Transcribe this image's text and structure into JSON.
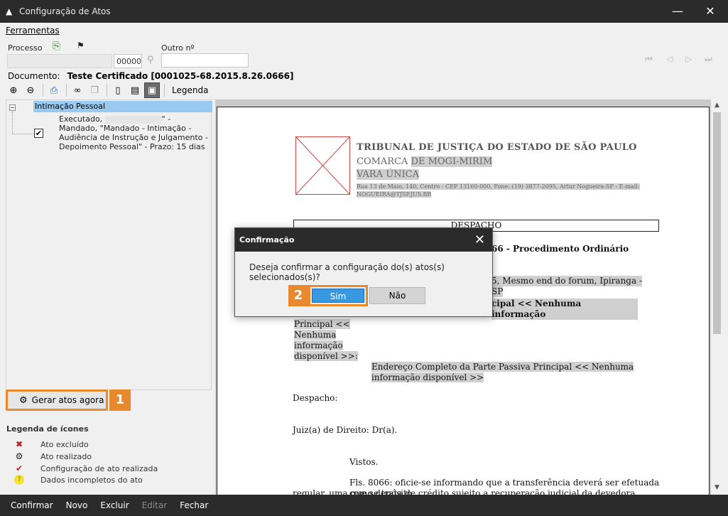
{
  "window": {
    "title": "Configuração de Atos",
    "minimize": "—",
    "close": "✕"
  },
  "menu": {
    "ferramentas": "Ferramentas"
  },
  "process": {
    "label_processo": "Processo",
    "label_outro": "Outro nº",
    "field_suffix": "00000"
  },
  "document": {
    "label": "Documento:",
    "value": "Teste Certificado [0001025-68.2015.8.26.0666]"
  },
  "toolbar": {
    "legend_label": "Legenda"
  },
  "tree": {
    "root_label": "Intimação Pessoal",
    "item_prefix": "Executado,",
    "item_text": "\" - Mandado, \"Mandado - Intimação - Audiência de Instrução e Julgamento - Depoimento Pessoal\" - Prazo: 15 dias"
  },
  "gerar_button": "Gerar atos agora",
  "steps": {
    "one": "1",
    "two": "2"
  },
  "legend": {
    "title": "Legenda de ícones",
    "items": [
      {
        "icon": "x-icon",
        "glyph": "✖",
        "color": "#c0201c",
        "label": "Ato excluído"
      },
      {
        "icon": "gear-icon",
        "glyph": "⚙",
        "color": "#222222",
        "label": "Ato realizado"
      },
      {
        "icon": "checkmark-icon",
        "glyph": "✔",
        "color": "#d0201c",
        "label": "Configuração de ato realizada"
      },
      {
        "icon": "question-icon",
        "glyph": "?",
        "color": "#e0b800",
        "label": "Dados incompletos do ato"
      }
    ]
  },
  "bottom": {
    "confirmar": "Confirmar",
    "novo": "Novo",
    "excluir": "Excluir",
    "editar": "Editar",
    "fechar": "Fechar"
  },
  "doc": {
    "court_line1": "TRIBUNAL DE JUSTIÇA DO ESTADO DE SÃO PAULO",
    "court_line2_a": "COMARCA",
    "court_line2_b": "DE MOGI-MIRIM",
    "court_line3": "VARA ÚNICA",
    "court_line4": "Rua 13 de Maio, 140, Centro - CEP 13160-000, Fone: (19) 3877-2095, Artur Nogueira-SP - E-mail: NOGUEIRA@TJSP.JUS.BR",
    "despacho_box": "DESPACHO",
    "proc_tail_num": "66",
    "proc_tail_label": "Procedimento Ordinário",
    "addr_fragment1": "5, Mesmo end do forum, Ipiranga -",
    "addr_fragment2": "SP",
    "addr_fragment3": "cipal << Nenhuma informação",
    "principal_block": [
      "Principal <<",
      "Nenhuma",
      "informação",
      "disponível >>:"
    ],
    "endereco_line1": "Endereço Completo da Parte Passiva Principal << Nenhuma",
    "endereco_line2": "informação disponível >>",
    "despacho_label": "Despacho:",
    "juiz": "Juiz(a) de Direito: Dr(a).",
    "vistos": "Vistos.",
    "fls_line1": "Fls. 8066: oficie-se informando que a transferência deverá ser efetuada como depósito",
    "fls_line2": "regular, uma que se trata de crédito sujeito a recuperação judicial da devedora."
  },
  "modal": {
    "title": "Confirmação",
    "message": "Deseja confirmar a configuração do(s) atos(s) selecionados(s)?",
    "yes": "Sim",
    "no": "Não"
  }
}
